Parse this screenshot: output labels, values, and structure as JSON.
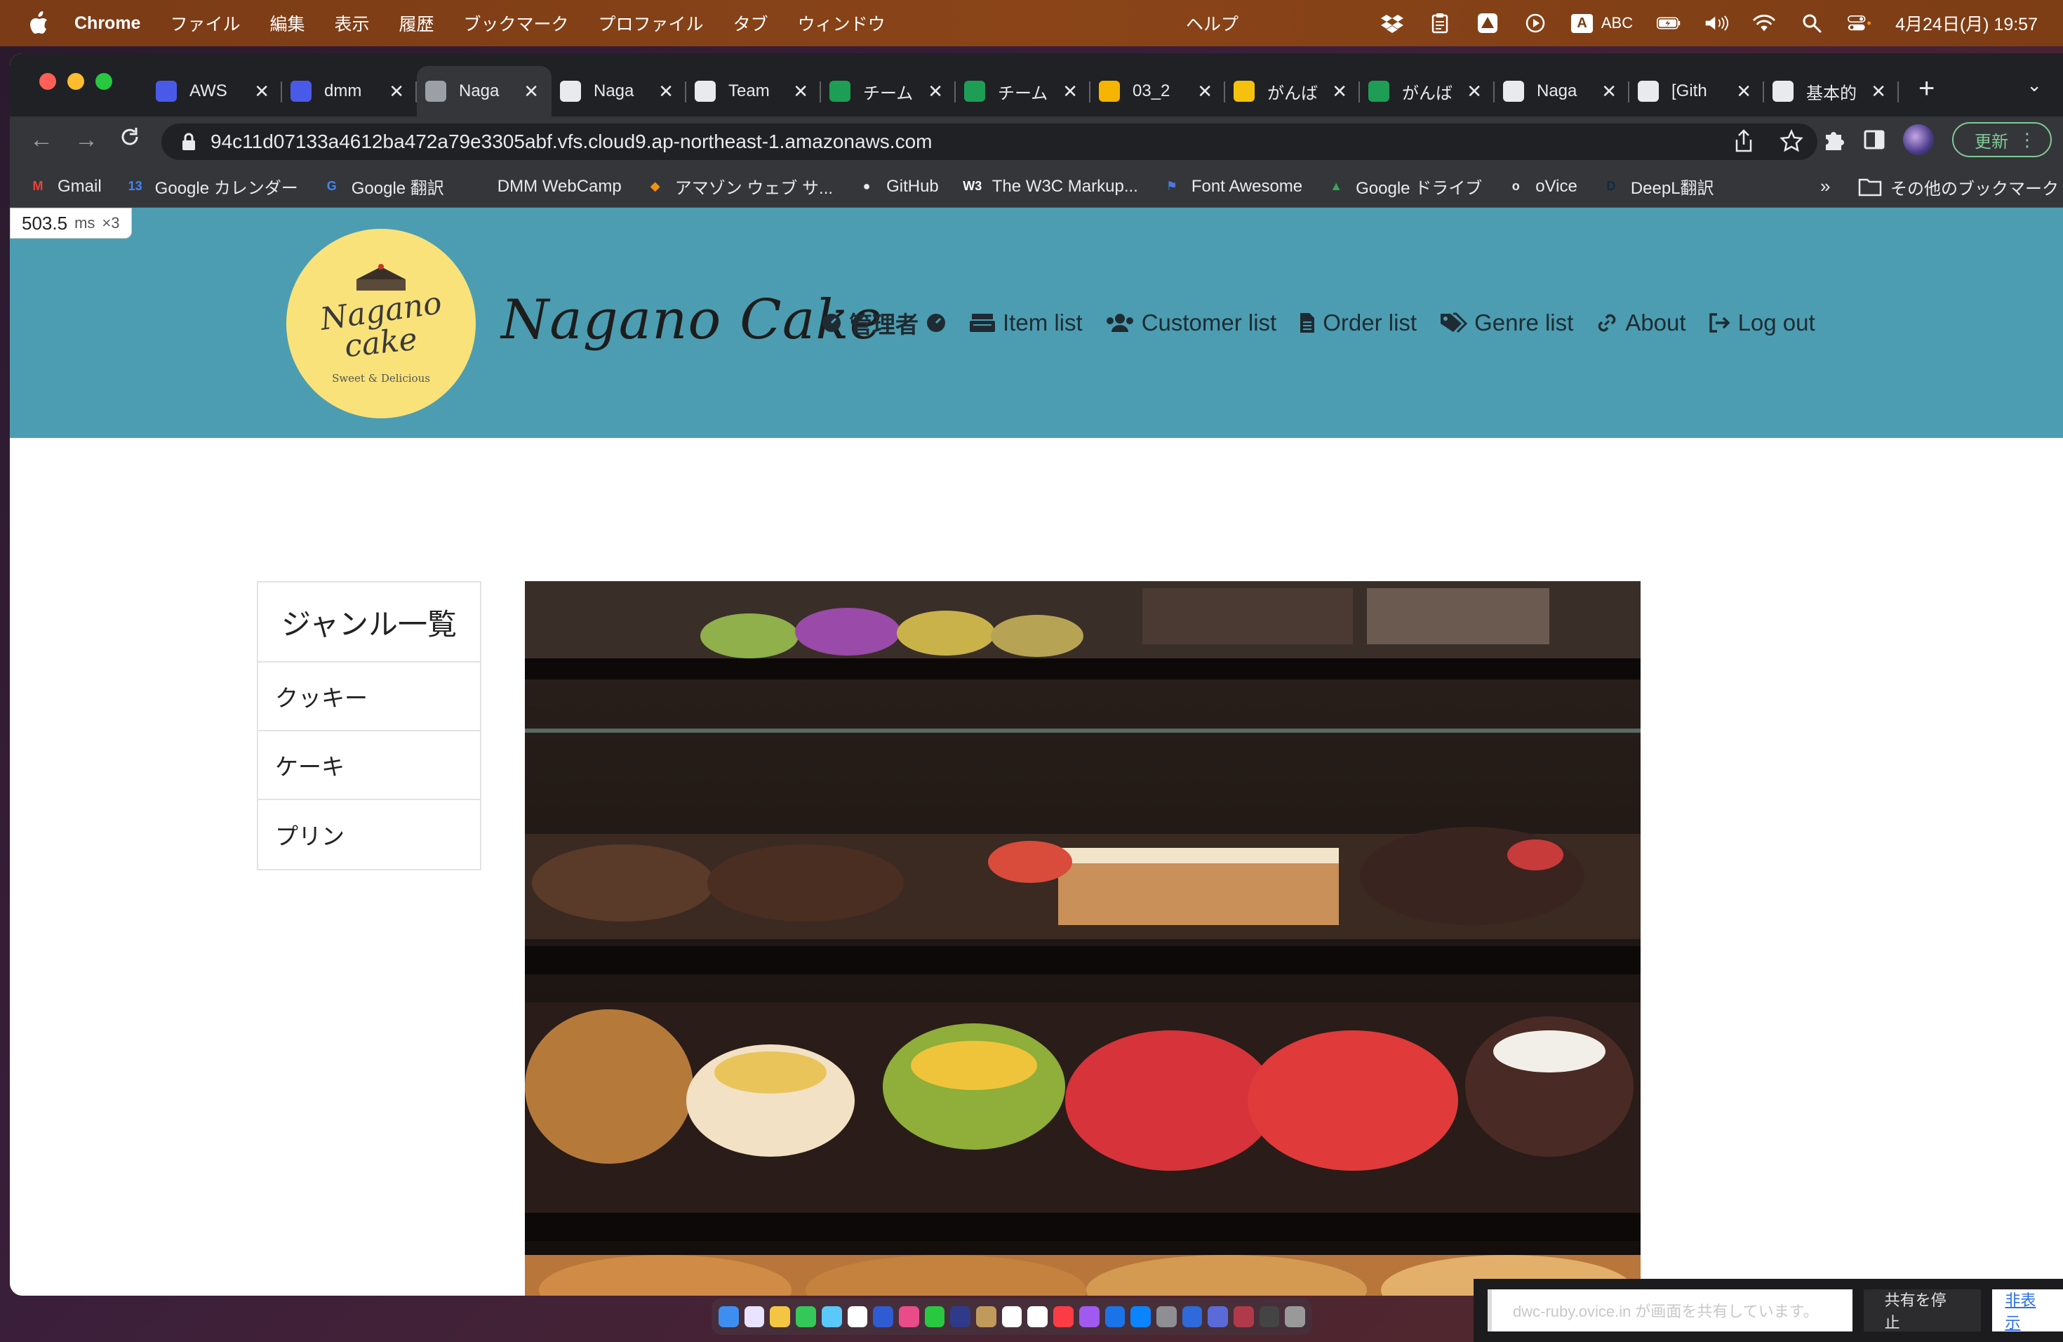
{
  "menubar": {
    "app": "Chrome",
    "items": [
      "ファイル",
      "編集",
      "表示",
      "履歴",
      "ブックマーク",
      "プロファイル",
      "タブ",
      "ウィンドウ"
    ],
    "help": "ヘルプ",
    "ime": "A",
    "ime_label": "ABC",
    "datetime": "4月24日(月)  19:57"
  },
  "tabs": [
    {
      "label": "AWS",
      "color": "#4a5ae8"
    },
    {
      "label": "dmm",
      "color": "#4a5ae8"
    },
    {
      "label": "Naga",
      "color": "#9aa0a6",
      "active": true
    },
    {
      "label": "Naga",
      "color": "#e8eaed"
    },
    {
      "label": "Team",
      "color": "#e8eaed"
    },
    {
      "label": "チーム",
      "color": "#1e9d55"
    },
    {
      "label": "チーム",
      "color": "#1e9d55"
    },
    {
      "label": "03_2",
      "color": "#f4b400"
    },
    {
      "label": "がんば",
      "color": "#f4c20d"
    },
    {
      "label": "がんば",
      "color": "#1e9d55"
    },
    {
      "label": "Naga",
      "color": "#e8eaed"
    },
    {
      "label": "[Gith",
      "color": "#e8eaed"
    },
    {
      "label": "基本的",
      "color": "#e8eaed"
    }
  ],
  "toolbar": {
    "url": "94c11d07133a4612ba472a79e3305abf.vfs.cloud9.ap-northeast-1.amazonaws.com",
    "update_label": "更新"
  },
  "bookmarks": [
    {
      "label": "Gmail",
      "icon": "M",
      "color": "#ea4335"
    },
    {
      "label": "Google カレンダー",
      "icon": "13",
      "color": "#4285f4"
    },
    {
      "label": "Google 翻訳",
      "icon": "G",
      "color": "#4285f4"
    },
    {
      "label": "DMM WebCamp",
      "icon": "W",
      "color": "#35363a"
    },
    {
      "label": "アマゾン ウェブ サ...",
      "icon": "◆",
      "color": "#f29111"
    },
    {
      "label": "GitHub",
      "icon": "●",
      "color": "#e8eaed"
    },
    {
      "label": "The W3C Markup...",
      "icon": "W3",
      "color": "#ffffff"
    },
    {
      "label": "Font Awesome",
      "icon": "⚑",
      "color": "#4a7ae8"
    },
    {
      "label": "Google ドライブ",
      "icon": "▲",
      "color": "#34a853"
    },
    {
      "label": "oVice",
      "icon": "o",
      "color": "#e8eaed"
    },
    {
      "label": "DeepL翻訳",
      "icon": "D",
      "color": "#0f2b46"
    }
  ],
  "bookmarks_more": "»",
  "bookmarks_other": "その他のブックマーク",
  "perf": {
    "value": "503.5",
    "unit": "ms",
    "count": "×3"
  },
  "site": {
    "logo_line1": "Nagano",
    "logo_line2": "cake",
    "logo_tagline": "Sweet & Delicious",
    "brand": "Nagano Cake",
    "nav": {
      "admin": "管理者",
      "item_list": "Item list",
      "customer_list": "Customer list",
      "order_list": "Order list",
      "genre_list": "Genre list",
      "about": "About",
      "logout": "Log out"
    },
    "header_color": "#4c9db1"
  },
  "sidebar": {
    "title": "ジャンル一覧",
    "genres": [
      "クッキー",
      "ケーキ",
      "プリン"
    ]
  },
  "sharebar": {
    "message": "dwc-ruby.ovice.in が画面を共有しています。",
    "stop": "共有を停止",
    "hide": "非表示"
  }
}
